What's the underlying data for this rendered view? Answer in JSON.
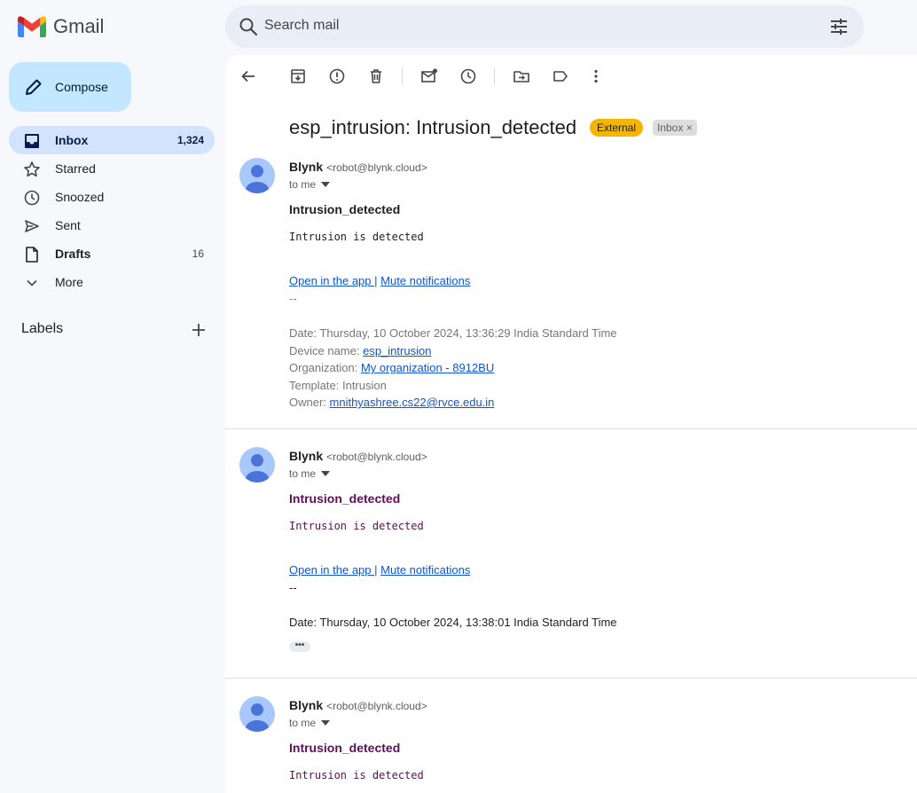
{
  "app": {
    "name": "Gmail"
  },
  "search": {
    "placeholder": "Search mail"
  },
  "compose": {
    "label": "Compose"
  },
  "nav": [
    {
      "label": "Inbox",
      "count": "1,324",
      "icon": "inbox-icon"
    },
    {
      "label": "Starred",
      "count": "",
      "icon": "star-icon"
    },
    {
      "label": "Snoozed",
      "count": "",
      "icon": "clock-icon"
    },
    {
      "label": "Sent",
      "count": "",
      "icon": "send-icon"
    },
    {
      "label": "Drafts",
      "count": "16",
      "icon": "draft-icon"
    },
    {
      "label": "More",
      "count": "",
      "icon": "chevron-down-icon"
    }
  ],
  "labels": {
    "heading": "Labels"
  },
  "thread": {
    "subject": "esp_intrusion: Intrusion_detected",
    "badge_external": "External",
    "badge_inbox": "Inbox",
    "badge_inbox_close": "×"
  },
  "messages": [
    {
      "sender": "Blynk",
      "email": "<robot@blynk.cloud>",
      "to": "to me",
      "title": "Intrusion_detected",
      "body": "Intrusion is detected",
      "link_open": "Open in the app ",
      "link_sep": "|",
      "link_mute": "Mute notifications",
      "dashes": "--",
      "date": "Date: Thursday, 10 October 2024, 13:36:29 India Standard Time",
      "device_label": "Device name: ",
      "device_value": "esp_intrusion",
      "org_label": "Organization: ",
      "org_value": "My organization - 8912BU",
      "template": "Template: Intrusion",
      "owner_label": "Owner: ",
      "owner_value": "mnithyashree.cs22@rvce.edu.in"
    },
    {
      "sender": "Blynk",
      "email": "<robot@blynk.cloud>",
      "to": "to me",
      "title": "Intrusion_detected",
      "body": "Intrusion is detected",
      "link_open": "Open in the app ",
      "link_sep": "|",
      "link_mute": "Mute notifications",
      "dashes": "--",
      "date": "Date: Thursday, 10 October 2024, 13:38:01 India Standard Time",
      "ellipsis": "•••"
    },
    {
      "sender": "Blynk",
      "email": "<robot@blynk.cloud>",
      "to": "to me",
      "title": "Intrusion_detected",
      "body": "Intrusion is detected"
    }
  ]
}
